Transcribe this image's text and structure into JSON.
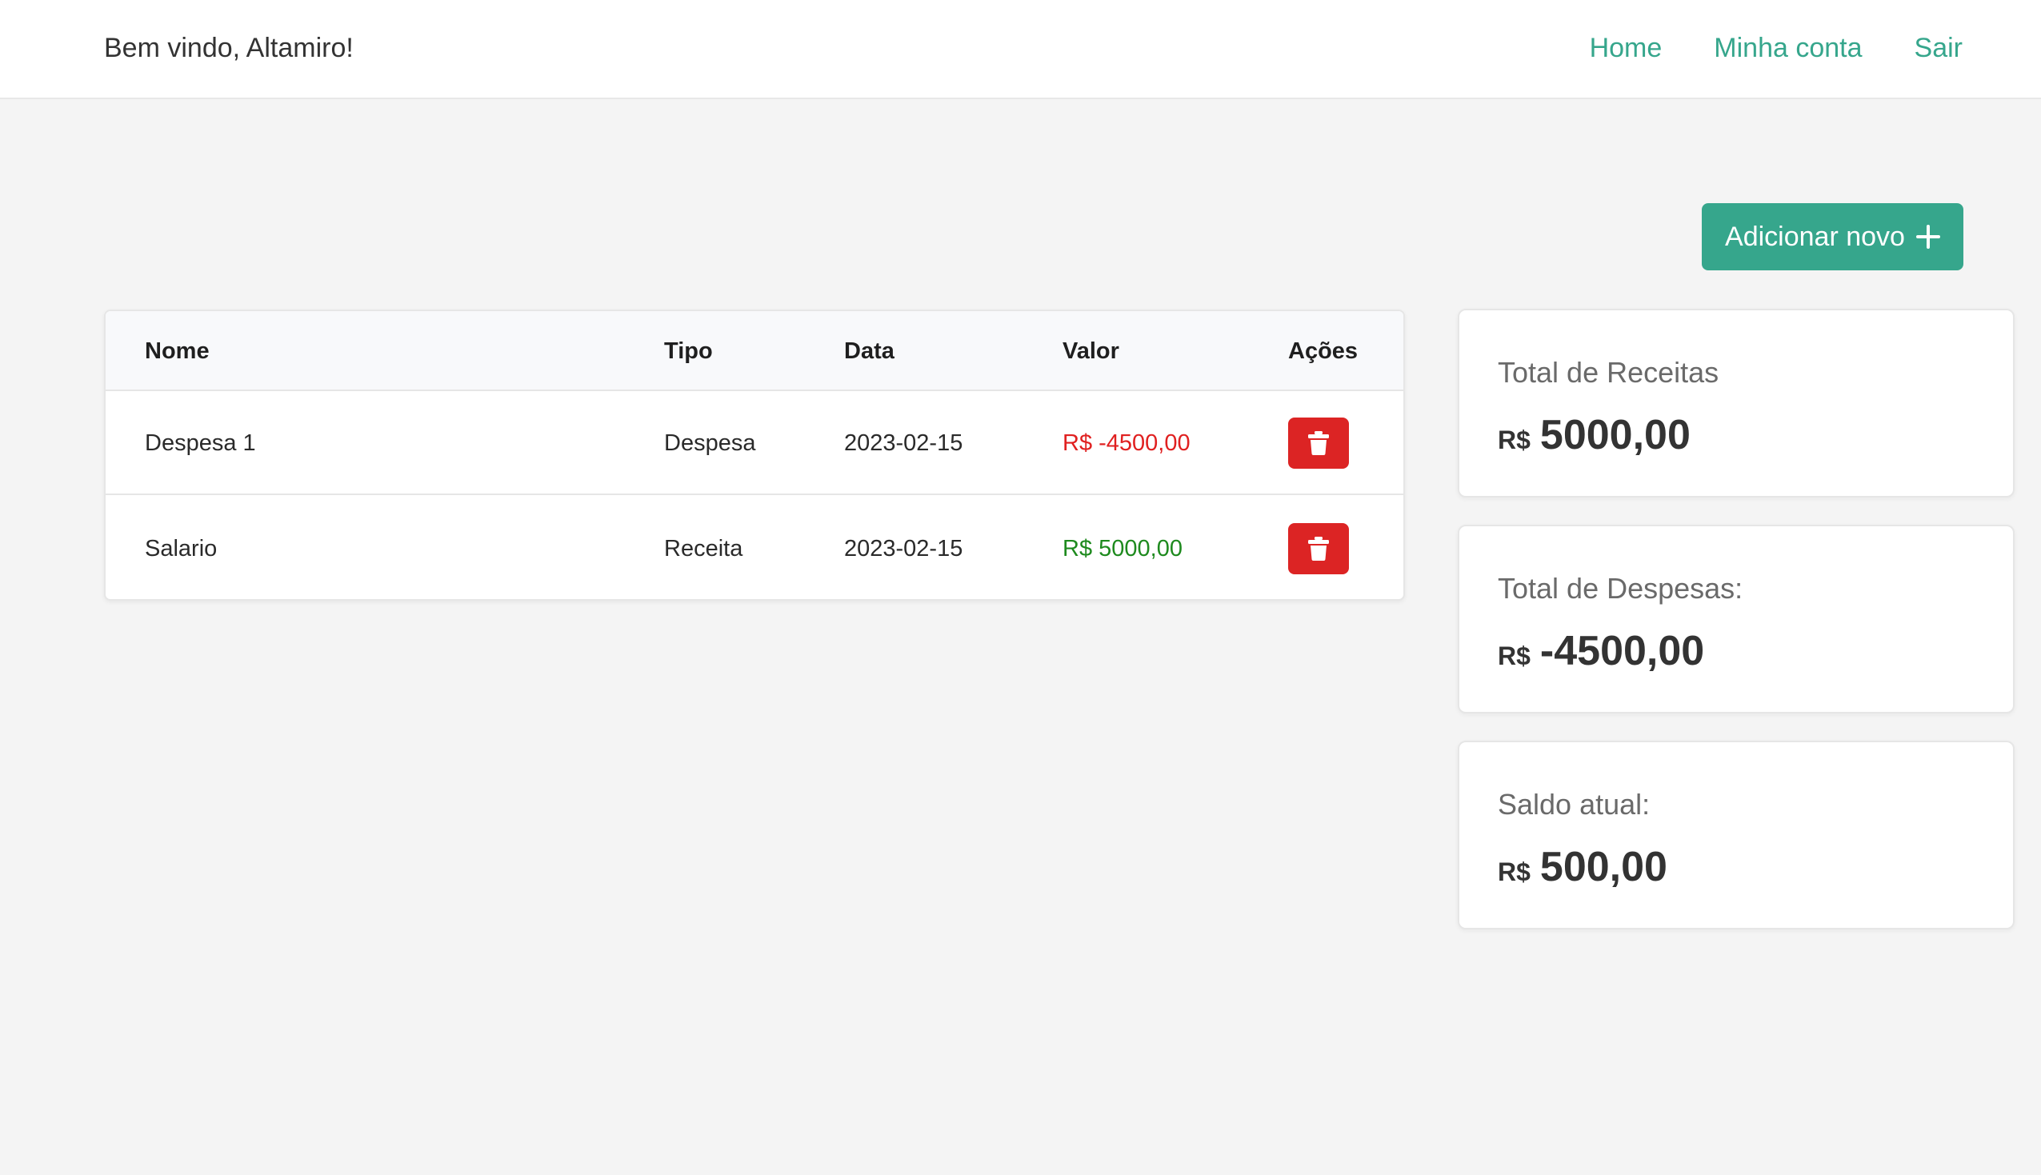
{
  "header": {
    "welcome": "Bem vindo, Altamiro!",
    "nav": [
      {
        "label": "Home"
      },
      {
        "label": "Minha conta"
      },
      {
        "label": "Sair"
      }
    ]
  },
  "actions": {
    "add_label": "Adicionar novo",
    "add_icon": "plus-icon"
  },
  "table": {
    "columns": [
      "Nome",
      "Tipo",
      "Data",
      "Valor",
      "Ações"
    ],
    "rows": [
      {
        "nome": "Despesa 1",
        "tipo": "Despesa",
        "data": "2023-02-15",
        "valor": "R$ -4500,00",
        "valor_color": "#e02020",
        "action_icon": "trash-icon"
      },
      {
        "nome": "Salario",
        "tipo": "Receita",
        "data": "2023-02-15",
        "valor": "R$ 5000,00",
        "valor_color": "#1e8a1e",
        "action_icon": "trash-icon"
      }
    ]
  },
  "summary": [
    {
      "label": "Total de Receitas",
      "currency": "R$",
      "amount": "5000,00"
    },
    {
      "label": "Total de Despesas:",
      "currency": "R$",
      "amount": "-4500,00"
    },
    {
      "label": "Saldo atual:",
      "currency": "R$",
      "amount": "500,00"
    }
  ],
  "colors": {
    "accent": "#36a68c",
    "danger": "#dc2424",
    "background": "#f4f4f4"
  }
}
